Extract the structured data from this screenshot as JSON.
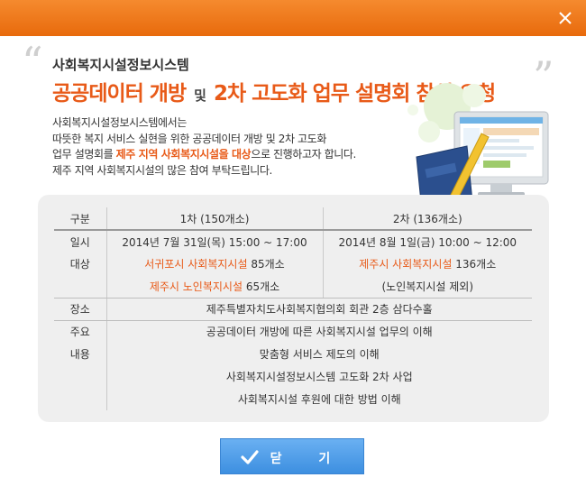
{
  "dialog": {
    "subtitle": "사회복지시설정보시스템",
    "title_part1": "공공데이터 개방",
    "title_conj": "및",
    "title_part2": "2차 고도화 업무 설명회 참석 요청",
    "intro": {
      "line1": "사회복지시설정보시스템에서는",
      "line2": "따뜻한 복지 서비스 실현을 위한 공공데이터 개방 및 2차 고도화",
      "line3_pre": "업무 설명회를 ",
      "line3_hl": "제주 지역 사회복지시설을 대상",
      "line3_post": "으로 진행하고자 합니다.",
      "line4": "제주 지역 사회복지시설의 많은 참여 부탁드립니다."
    },
    "table": {
      "header": {
        "label": "구분",
        "col1": "1차 (150개소)",
        "col2": "2차 (136개소)"
      },
      "schedule": {
        "label": "일시",
        "col1": "2014년 7월 31일(목) 15:00 ~ 17:00",
        "col2": "2014년 8월 1일(금) 10:00 ~ 12:00"
      },
      "target": {
        "label": "대상",
        "col1_row1_hl": "서귀포시 사회복지시설",
        "col1_row1_rest": " 85개소",
        "col1_row2_hl": "제주시 노인복지시설",
        "col1_row2_rest": " 65개소",
        "col2_row1_hl": "제주시 사회복지시설",
        "col2_row1_rest": " 136개소",
        "col2_row2": "(노인복지시설 제외)"
      },
      "venue": {
        "label": "장소",
        "value": "제주특별자치도사회복지협의회 회관 2층 삼다수홀"
      },
      "content": {
        "label1": "주요",
        "label2": "내용",
        "items": [
          "공공데이터 개방에 따른 사회복지시설 업무의 이해",
          "맞춤형 서비스 제도의 이해",
          "사회복지시설정보시스템 고도화 2차 사업",
          "사회복지시설 후원에 대한 방법 이해"
        ]
      }
    },
    "close_button_label": "닫 기"
  },
  "colors": {
    "titlebar": "#ef7a1c",
    "accent": "#e85a18",
    "button": "#4a9ae8",
    "box": "#efefef"
  },
  "icons": {
    "close": "close-icon",
    "check": "checkmark-icon",
    "illustration": "monitor-book-pencil-illustration"
  }
}
